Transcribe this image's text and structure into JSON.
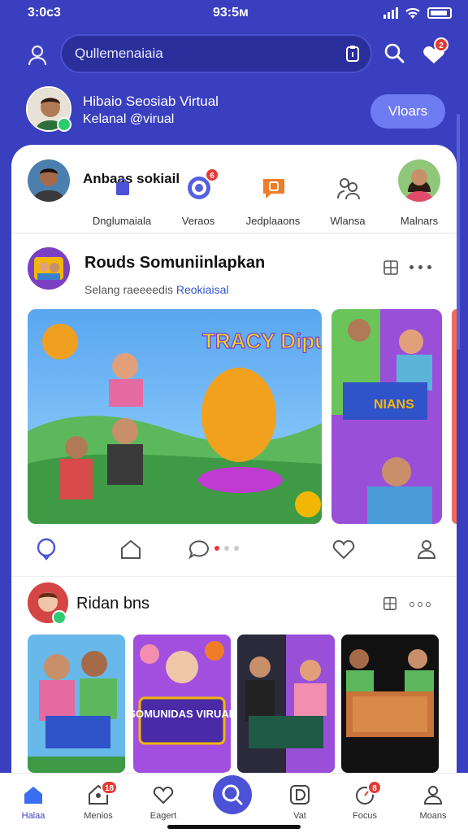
{
  "status": {
    "time_left": "3:0ᴄ3",
    "time_center": "93:5ᴍ"
  },
  "search": {
    "placeholder": "Qullemenaiaia"
  },
  "notifications": {
    "badge": "2"
  },
  "profile": {
    "name": "Hibaio Seosiab Virtual",
    "subtitle": "Kelanal @virual",
    "button": "Vloars"
  },
  "stories": {
    "title": "Anbaas sokiail",
    "items": [
      {
        "label": "Dnglumaiala",
        "icon": "bag-icon"
      },
      {
        "label": "Veraos",
        "icon": "target-icon",
        "badge": "6"
      },
      {
        "label": "Jedplaaons",
        "icon": "chat-icon"
      },
      {
        "label": "Wlansa",
        "icon": "people-icon"
      },
      {
        "label": "Malnars",
        "icon": "avatar"
      }
    ]
  },
  "post": {
    "title": "Rouds Somuniinlapkan",
    "subtitle": "Selang raeeeedis",
    "subtitle_link": "Reokiaisal",
    "image_main_text": "TRACY Dipulias",
    "image_side_text": "NIANS"
  },
  "section2": {
    "title": "Ridan bns",
    "thumb2_text": "SOMUNIDAS VIRUAL"
  },
  "bottom_nav": [
    {
      "label": "Halaa",
      "icon": "home-icon",
      "active": true
    },
    {
      "label": "Menios",
      "icon": "profile-icon",
      "badge": "18"
    },
    {
      "label": "Eagert",
      "icon": "heart-icon"
    },
    {
      "label": "",
      "icon": "add-icon"
    },
    {
      "label": "Vat",
      "icon": "chat-d-icon"
    },
    {
      "label": "Focus",
      "icon": "gauge-icon",
      "badge": "8"
    },
    {
      "label": "Moans",
      "icon": "user-icon"
    }
  ],
  "colors": {
    "brand": "#3a3fbf",
    "accent": "#6f7bf2",
    "badge": "#e53935"
  }
}
